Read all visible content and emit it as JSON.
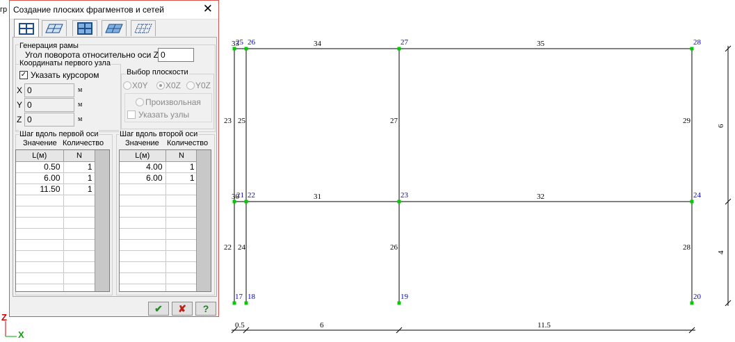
{
  "background_fragment": "гр",
  "dialog": {
    "title": "Создание плоских фрагментов и сетей",
    "close_glyph": "✕",
    "tabs": [
      {
        "name": "frame-tab",
        "icon": "frame-icon",
        "active": true
      },
      {
        "name": "plate-tab",
        "icon": "plate-grid-icon",
        "active": false
      },
      {
        "name": "mesh-tab",
        "icon": "mesh-icon",
        "active": false
      },
      {
        "name": "shell-tab",
        "icon": "shell-icon",
        "active": false
      },
      {
        "name": "hatch-tab",
        "icon": "hatch-grid-icon",
        "active": false
      }
    ],
    "frame_generation": {
      "group_label": "Генерация  рамы",
      "rotation_label": "Угол поворота относительно оси Z",
      "rotation_value": "0"
    },
    "first_node": {
      "group_label": "Координаты первого узла",
      "cursor_checkbox_label": "Указать курсором",
      "cursor_checked": true,
      "x_label": "X",
      "x_value": "0",
      "y_label": "Y",
      "y_value": "0",
      "z_label": "Z",
      "z_value": "0",
      "unit": "м"
    },
    "plane_choice": {
      "group_label": "Выбор плоскости",
      "options": [
        "X0Y",
        "X0Z",
        "Y0Z"
      ],
      "selected": "X0Z",
      "arbitrary_label": "Произвольная",
      "nodes_checkbox_label": "Указать узлы"
    },
    "step_first_axis": {
      "group_label": "Шаг вдоль первой оси",
      "value_label": "Значение",
      "count_label": "Количество",
      "col_l": "L(м)",
      "col_n": "N",
      "rows": [
        {
          "l": "0.50",
          "n": "1"
        },
        {
          "l": "6.00",
          "n": "1"
        },
        {
          "l": "11.50",
          "n": "1"
        }
      ]
    },
    "step_second_axis": {
      "group_label": "Шаг вдоль второй оси",
      "value_label": "Значение",
      "count_label": "Количество",
      "col_l": "L(м)",
      "col_n": "N",
      "rows": [
        {
          "l": "4.00",
          "n": "1"
        },
        {
          "l": "6.00",
          "n": "1"
        }
      ]
    },
    "buttons": {
      "apply_glyph": "✔",
      "cancel_glyph": "✘",
      "help_glyph": "?"
    }
  },
  "axes_indicator": {
    "z_label": "Z",
    "x_label": "X"
  },
  "drawing": {
    "node_color": "#00cc00",
    "node_label_color": "#0000cc",
    "bays_x_m": [
      "0.5",
      "6",
      "11.5"
    ],
    "storeys_z_m": [
      "4",
      "6"
    ],
    "node_labels": {
      "bottom": [
        "17",
        "18",
        "19",
        "20"
      ],
      "middle": [
        "21",
        "22",
        "23",
        "24"
      ],
      "top": [
        "25",
        "26",
        "27",
        "28"
      ],
      "middle_overlap": "30",
      "top_overlap": "33"
    },
    "element_labels": {
      "col_lower": [
        "22",
        "24",
        "26",
        "28"
      ],
      "col_upper": [
        "23",
        "25",
        "27",
        "29"
      ],
      "beam_mid": [
        "31",
        "32"
      ],
      "beam_top": [
        "34",
        "35"
      ]
    }
  }
}
